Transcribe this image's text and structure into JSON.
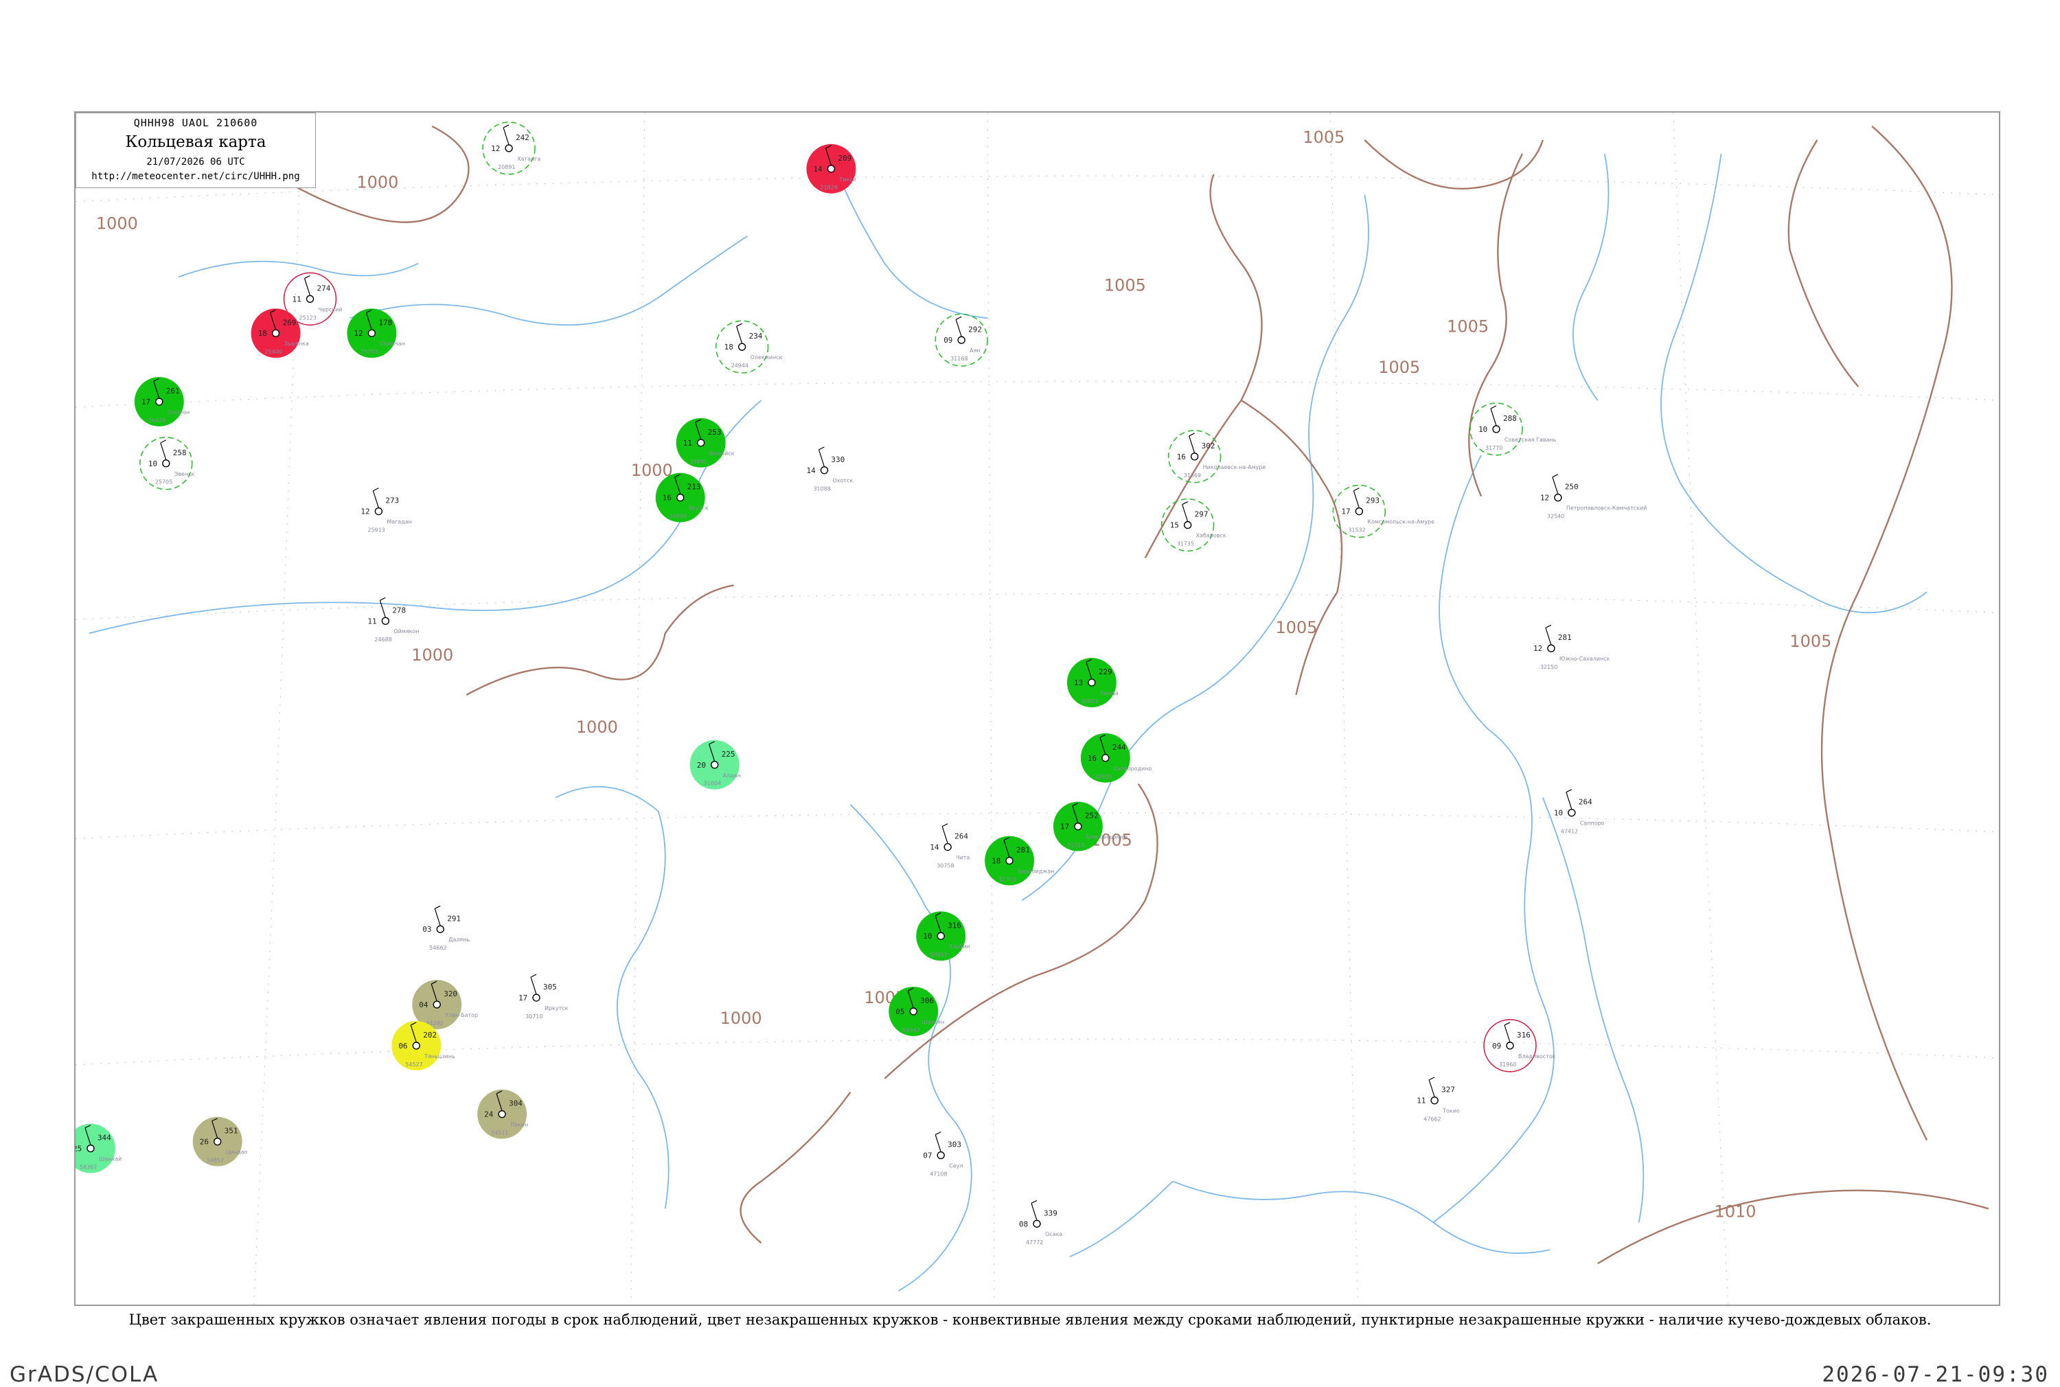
{
  "header": {
    "code": "QHHH98  UAOL  210600",
    "title": "Кольцевая карта",
    "time": "21/07/2026 06 UTC",
    "url": "http://meteocenter.net/circ/UHHH.png"
  },
  "caption": "Цвет закрашенных кружков означает явления погоды в срок наблюдений, цвет незакрашенных кружков - конвективные явления между сроками наблюдений, пунктирные незакрашенные кружки - наличие кучево-дождевых облаков.",
  "footer": {
    "left": "GrADS/COLA",
    "right": "2026-07-21-09:30"
  },
  "colors": {
    "rain": "#11c411",
    "thunder": "#ee2244",
    "shower": "#66ee99",
    "fog": "#b5b584",
    "haze": "#eeee22",
    "convective_ring": "#cc2244",
    "cb_ring": "#33bb33",
    "isobar": "#a87868",
    "river": "#7cb8e8"
  },
  "isobar_labels": [
    "1000",
    "1005",
    "1010"
  ],
  "stations": [
    {
      "name": "Черский",
      "id": "25123",
      "p": "274",
      "t": "11",
      "cat": "convective"
    },
    {
      "name": "Зырянка",
      "id": "25400",
      "p": "269",
      "t": "18",
      "cat": "thunder"
    },
    {
      "name": "Сеймчан",
      "id": "25703",
      "p": "178",
      "t": "12",
      "cat": "rain"
    },
    {
      "name": "Омолон",
      "id": "25428",
      "p": "261",
      "t": "17",
      "cat": "rain"
    },
    {
      "name": "Эвенск",
      "id": "25705",
      "p": "258",
      "t": "10",
      "cat": "cb"
    },
    {
      "name": "Магадан",
      "id": "25913",
      "p": "273",
      "t": "12",
      "cat": "none"
    },
    {
      "name": "Оймякон",
      "id": "24688",
      "p": "278",
      "t": "11",
      "cat": "none"
    },
    {
      "name": "Охотск",
      "id": "31088",
      "p": "330",
      "t": "14",
      "cat": "none"
    },
    {
      "name": "Аян",
      "id": "31168",
      "p": "292",
      "t": "09",
      "cat": "cb"
    },
    {
      "name": "Николаевск-на-Амуре",
      "id": "31369",
      "p": "302",
      "t": "16",
      "cat": "cb"
    },
    {
      "name": "Хабаровск",
      "id": "31735",
      "p": "297",
      "t": "15",
      "cat": "cb"
    },
    {
      "name": "Комсомольск-на-Амуре",
      "id": "31532",
      "p": "293",
      "t": "17",
      "cat": "cb"
    },
    {
      "name": "Советская Гавань",
      "id": "31770",
      "p": "288",
      "t": "10",
      "cat": "cb"
    },
    {
      "name": "Якутск",
      "id": "24959",
      "p": "213",
      "t": "16",
      "cat": "rain"
    },
    {
      "name": "Олекминск",
      "id": "24944",
      "p": "234",
      "t": "18",
      "cat": "cb"
    },
    {
      "name": "Вилюйск",
      "id": "24641",
      "p": "253",
      "t": "11",
      "cat": "rain"
    },
    {
      "name": "Алдан",
      "id": "31004",
      "p": "225",
      "t": "20",
      "cat": "shower"
    },
    {
      "name": "Тында",
      "id": "30823",
      "p": "229",
      "t": "13",
      "cat": "rain"
    },
    {
      "name": "Сковородино",
      "id": "30935",
      "p": "244",
      "t": "16",
      "cat": "rain"
    },
    {
      "name": "Благовещенск",
      "id": "31510",
      "p": "252",
      "t": "17",
      "cat": "rain"
    },
    {
      "name": "Биробиджан",
      "id": "31713",
      "p": "281",
      "t": "18",
      "cat": "rain"
    },
    {
      "name": "Владивосток",
      "id": "31960",
      "p": "316",
      "t": "09",
      "cat": "convective"
    },
    {
      "name": "Харбин",
      "id": "50953",
      "p": "316",
      "t": "10",
      "cat": "rain"
    },
    {
      "name": "Пекин",
      "id": "54511",
      "p": "304",
      "t": "24",
      "cat": "fog"
    },
    {
      "name": "Улан-Батор",
      "id": "44292",
      "p": "320",
      "t": "04",
      "cat": "fog"
    },
    {
      "name": "Шэньян",
      "id": "54342",
      "p": "306",
      "t": "05",
      "cat": "rain"
    },
    {
      "name": "Сеул",
      "id": "47108",
      "p": "303",
      "t": "07",
      "cat": "none"
    },
    {
      "name": "Токио",
      "id": "47662",
      "p": "327",
      "t": "11",
      "cat": "none"
    },
    {
      "name": "Саппоро",
      "id": "47412",
      "p": "264",
      "t": "10",
      "cat": "none"
    },
    {
      "name": "Южно-Сахалинск",
      "id": "32150",
      "p": "281",
      "t": "12",
      "cat": "none"
    },
    {
      "name": "Петропавловск-Камчатский",
      "id": "32540",
      "p": "250",
      "t": "12",
      "cat": "none"
    },
    {
      "name": "Хатанга",
      "id": "20891",
      "p": "242",
      "t": "12",
      "cat": "cb"
    },
    {
      "name": "Тикси",
      "id": "21824",
      "p": "209",
      "t": "14",
      "cat": "thunder"
    },
    {
      "name": "Чита",
      "id": "30758",
      "p": "264",
      "t": "14",
      "cat": "none"
    },
    {
      "name": "Иркутск",
      "id": "30710",
      "p": "305",
      "t": "17",
      "cat": "none"
    },
    {
      "name": "Шанхай",
      "id": "58367",
      "p": "344",
      "t": "25",
      "cat": "shower"
    },
    {
      "name": "Циндао",
      "id": "54857",
      "p": "351",
      "t": "26",
      "cat": "fog"
    },
    {
      "name": "Тяньцзинь",
      "id": "54527",
      "p": "202",
      "t": "06",
      "cat": "haze"
    },
    {
      "name": "Далянь",
      "id": "54662",
      "p": "291",
      "t": "03",
      "cat": "none"
    },
    {
      "name": "Осака",
      "id": "47772",
      "p": "339",
      "t": "08",
      "cat": "none"
    }
  ]
}
